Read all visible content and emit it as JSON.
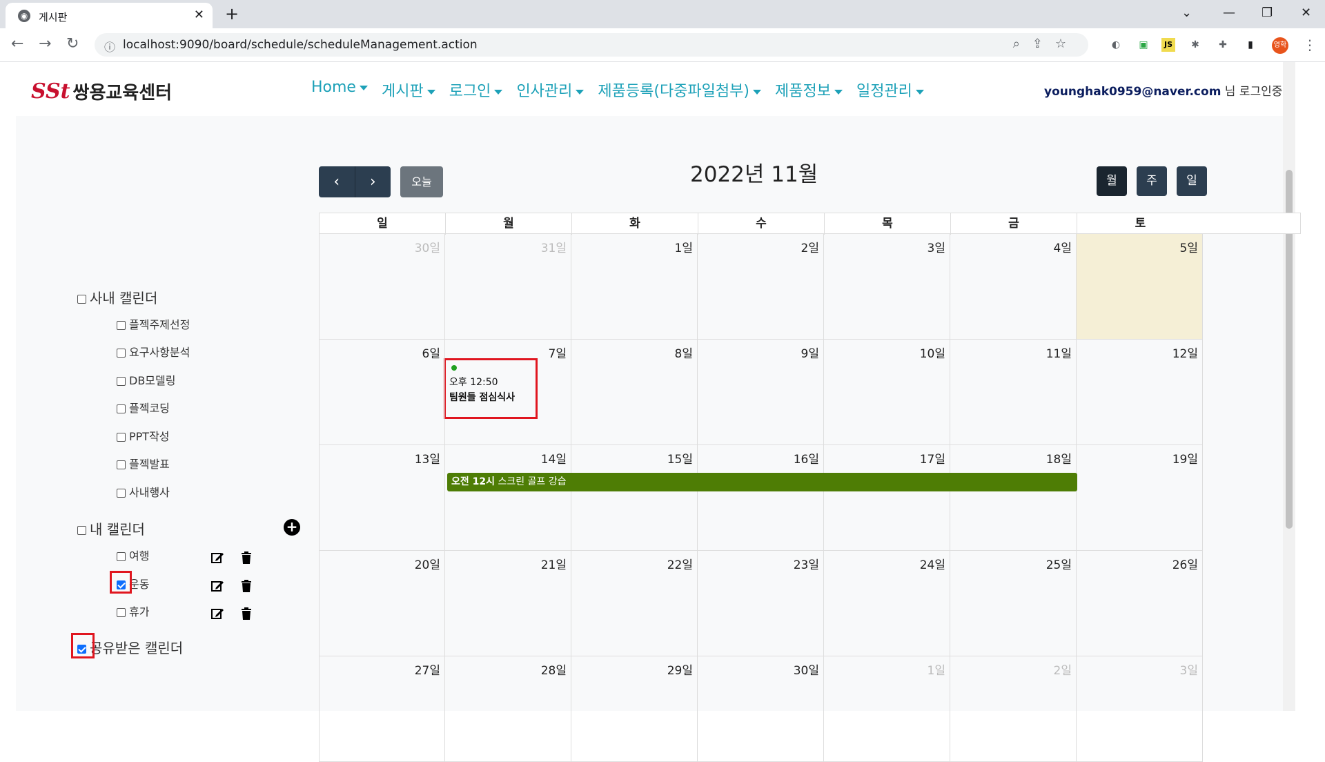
{
  "browser": {
    "tab_title": "게시판",
    "url": "localhost:9090/board/schedule/scheduleManagement.action",
    "profile_label": "영학"
  },
  "site": {
    "logo_mark": "SSt",
    "logo_text": "쌍용교육센터",
    "nav": [
      "Home",
      "게시판",
      "로그인",
      "인사관리",
      "제품등록(다중파일첨부)",
      "제품정보",
      "일정관리"
    ],
    "user_email": "younghak0959@naver.com",
    "user_suffix": " 님 로그인중.."
  },
  "sidebar": {
    "company_calendar": "사내 캘린더",
    "company_items": [
      "플젝주제선정",
      "요구사항분석",
      "DB모델링",
      "플젝코딩",
      "PPT작성",
      "플젝발표",
      "사내행사"
    ],
    "my_calendar": "내 캘린더",
    "my_items": [
      {
        "label": "여행",
        "checked": false
      },
      {
        "label": "운동",
        "checked": true
      },
      {
        "label": "휴가",
        "checked": false
      }
    ],
    "shared_calendar": "공유받은 캘린더",
    "shared_checked": true
  },
  "calendar": {
    "title": "2022년 11월",
    "today_label": "오늘",
    "view_buttons": [
      "월",
      "주",
      "일"
    ],
    "weekdays": [
      "일",
      "월",
      "화",
      "수",
      "목",
      "금",
      "토"
    ],
    "weeks": [
      [
        "30일",
        "31일",
        "1일",
        "2일",
        "3일",
        "4일",
        "5일"
      ],
      [
        "6일",
        "7일",
        "8일",
        "9일",
        "10일",
        "11일",
        "12일"
      ],
      [
        "13일",
        "14일",
        "15일",
        "16일",
        "17일",
        "18일",
        "19일"
      ],
      [
        "20일",
        "21일",
        "22일",
        "23일",
        "24일",
        "25일",
        "26일"
      ],
      [
        "27일",
        "28일",
        "29일",
        "30일",
        "1일",
        "2일",
        "3일"
      ]
    ],
    "events": {
      "lunch_time": "오후 12:50",
      "lunch_title": "팀원들 점심식사",
      "golf_time": "오전 12시",
      "golf_title": " 스크린 골프 강습"
    },
    "colors": {
      "today_highlight": "#f5efd6",
      "golf_event": "#4e7d05",
      "lunch_dot": "#20a020",
      "toolbar": "#2c3e50",
      "annotation_red": "#e0161f"
    }
  }
}
